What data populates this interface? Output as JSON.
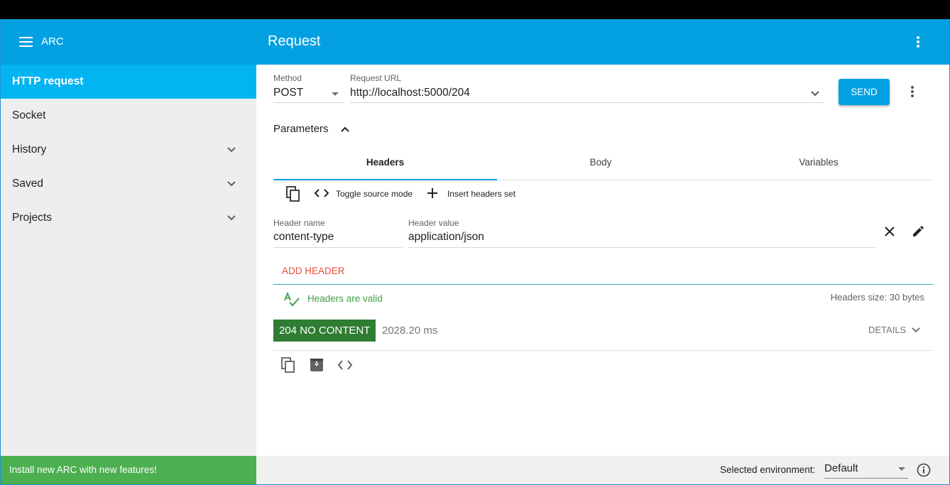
{
  "app": {
    "name": "ARC",
    "page_title": "Request"
  },
  "sidebar": {
    "items": [
      {
        "label": "HTTP request",
        "active": true
      },
      {
        "label": "Socket"
      },
      {
        "label": "History"
      },
      {
        "label": "Saved"
      },
      {
        "label": "Projects"
      }
    ],
    "install_banner": "Install new ARC with new features!"
  },
  "request": {
    "method_label": "Method",
    "method_value": "POST",
    "url_label": "Request URL",
    "url_value": "http://localhost:5000/204",
    "send_label": "SEND"
  },
  "parameters": {
    "toggle_label": "Parameters",
    "tabs": [
      {
        "label": "Headers",
        "active": true
      },
      {
        "label": "Body"
      },
      {
        "label": "Variables"
      }
    ],
    "toolbar": {
      "toggle_source": "Toggle source mode",
      "insert_set": "Insert headers set"
    },
    "header_row": {
      "name_label": "Header name",
      "name_value": "content-type",
      "value_label": "Header value",
      "value_value": "application/json"
    },
    "add_header": "ADD HEADER",
    "valid_text": "Headers are valid",
    "size_text": "Headers size: 30 bytes"
  },
  "response": {
    "status": "204 NO CONTENT",
    "time": "2028.20 ms",
    "details": "DETAILS"
  },
  "footer": {
    "env_label": "Selected environment:",
    "env_value": "Default"
  },
  "colors": {
    "primary": "#03a0e2",
    "active_nav": "#03b4f3",
    "install_green": "#4caf50",
    "status_green": "#2e7d32",
    "add_header_red": "#e74c3c"
  }
}
